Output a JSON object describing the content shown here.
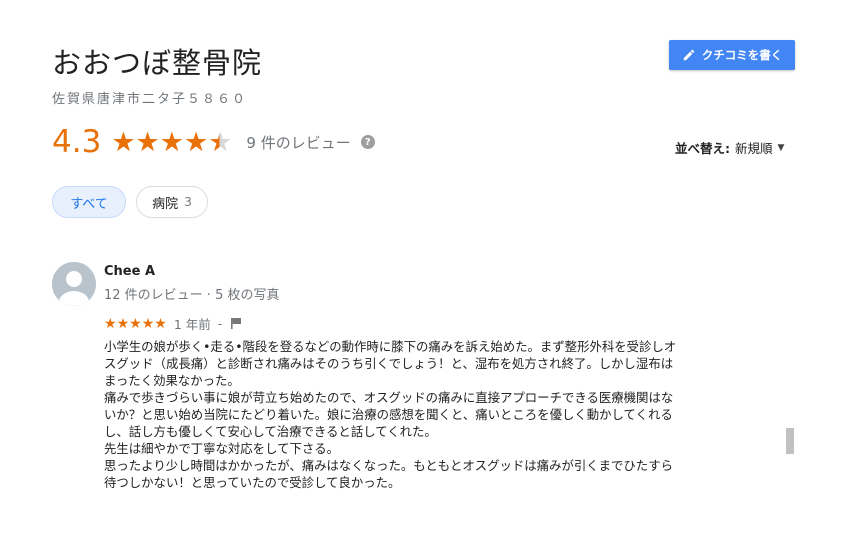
{
  "place": {
    "name": "おおつぼ整骨院",
    "address": "佐賀県唐津市二タ子５８６０"
  },
  "write_review_label": "クチコミを書く",
  "summary": {
    "rating": "4.3",
    "stars_value": 4.3,
    "review_count_text": "9 件のレビュー"
  },
  "sort": {
    "label": "並べ替え:",
    "value": "新規順"
  },
  "filters": {
    "all_label": "すべて",
    "hospital_label": "病院",
    "hospital_count": "3"
  },
  "review": {
    "reviewer_name": "Chee A",
    "reviewer_meta": "12 件のレビュー · 5 枚の写真",
    "stars": 5,
    "time": "1 年前",
    "separator": "-",
    "lines": [
      "小学生の娘が歩く•走る•階段を登るなどの動作時に膝下の痛みを訴え始めた。まず整形外科を受診しオ",
      "スグッド（成長痛）と診断され痛みはそのうち引くでしょう！と、湿布を処方され終了。しかし湿布は",
      "まったく効果なかった。",
      "痛みで歩きづらい事に娘が苛立ち始めたので、オスグッドの痛みに直接アプローチできる医療機関はな",
      "いか？と思い始め当院にたどり着いた。娘に治療の感想を聞くと、痛いところを優しく動かしてくれる",
      "し、話し方も優しくて安心して治療できると話してくれた。",
      "先生は細やかで丁寧な対応をして下さる。",
      "思ったより少し時間はかかったが、痛みはなくなった。もともとオスグッドは痛みが引くまでひたすら",
      "待つしかない！と思っていたので受診して良かった。"
    ]
  },
  "colors": {
    "accent": "#e8710a",
    "button": "#4285f4",
    "chip_active_bg": "#e8f0fe",
    "chip_active_text": "#1a73e8"
  },
  "icons": [
    "pencil-icon",
    "star-icon",
    "help-icon",
    "dropdown-arrow-icon",
    "avatar-icon",
    "flag-icon"
  ]
}
